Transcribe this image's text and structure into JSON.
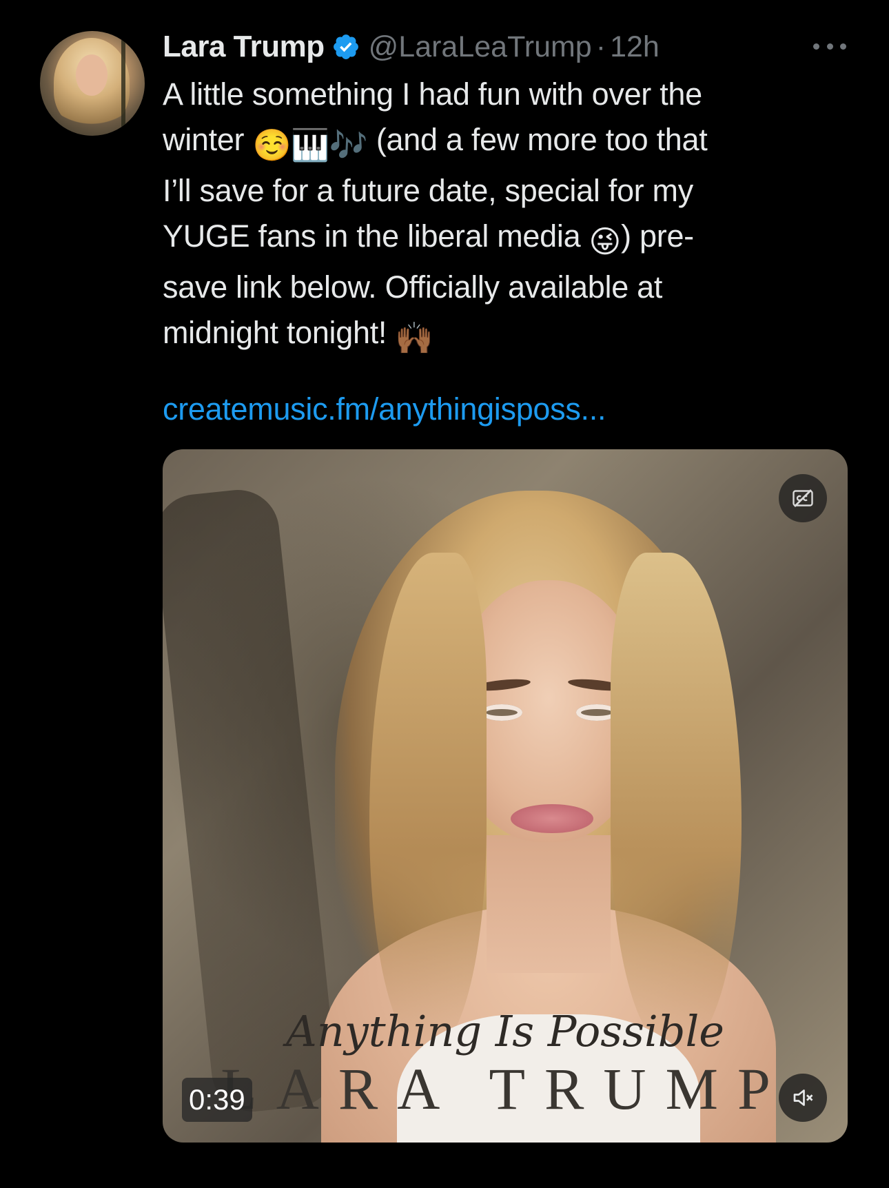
{
  "tweet": {
    "author": {
      "display_name": "Lara Trump",
      "handle": "@LaraLeaTrump",
      "verified": true,
      "avatar_icon": "profile-photo"
    },
    "separator": "·",
    "time": "12h",
    "more_icon": "more-horizontal-icon",
    "text_lines": [
      "A little something I had fun with over the",
      "winter",
      "(and a few more too that",
      "I’ll save for a future date, special for my",
      "YUGE fans in the liberal media",
      ") pre-",
      "save link below. Officially available at",
      "midnight tonight!"
    ],
    "emojis": {
      "smiling": "☺️",
      "piano": "🎹",
      "notes": "🎶",
      "winking_tongue": "😜",
      "raising_hands": "🙌🏾"
    },
    "link_text": "createmusic.fm/anythingisposs..."
  },
  "media": {
    "type": "video",
    "cover_title": "Anything Is Possible",
    "cover_artist": "LARA TRUMP",
    "duration": "0:39",
    "captions_icon": "captions-off-icon",
    "mute_icon": "volume-muted-icon"
  },
  "colors": {
    "background": "#000000",
    "primary_text": "#e7e9ea",
    "secondary_text": "#71767b",
    "link": "#1d9bf0",
    "verified_badge": "#1d9bf0"
  }
}
